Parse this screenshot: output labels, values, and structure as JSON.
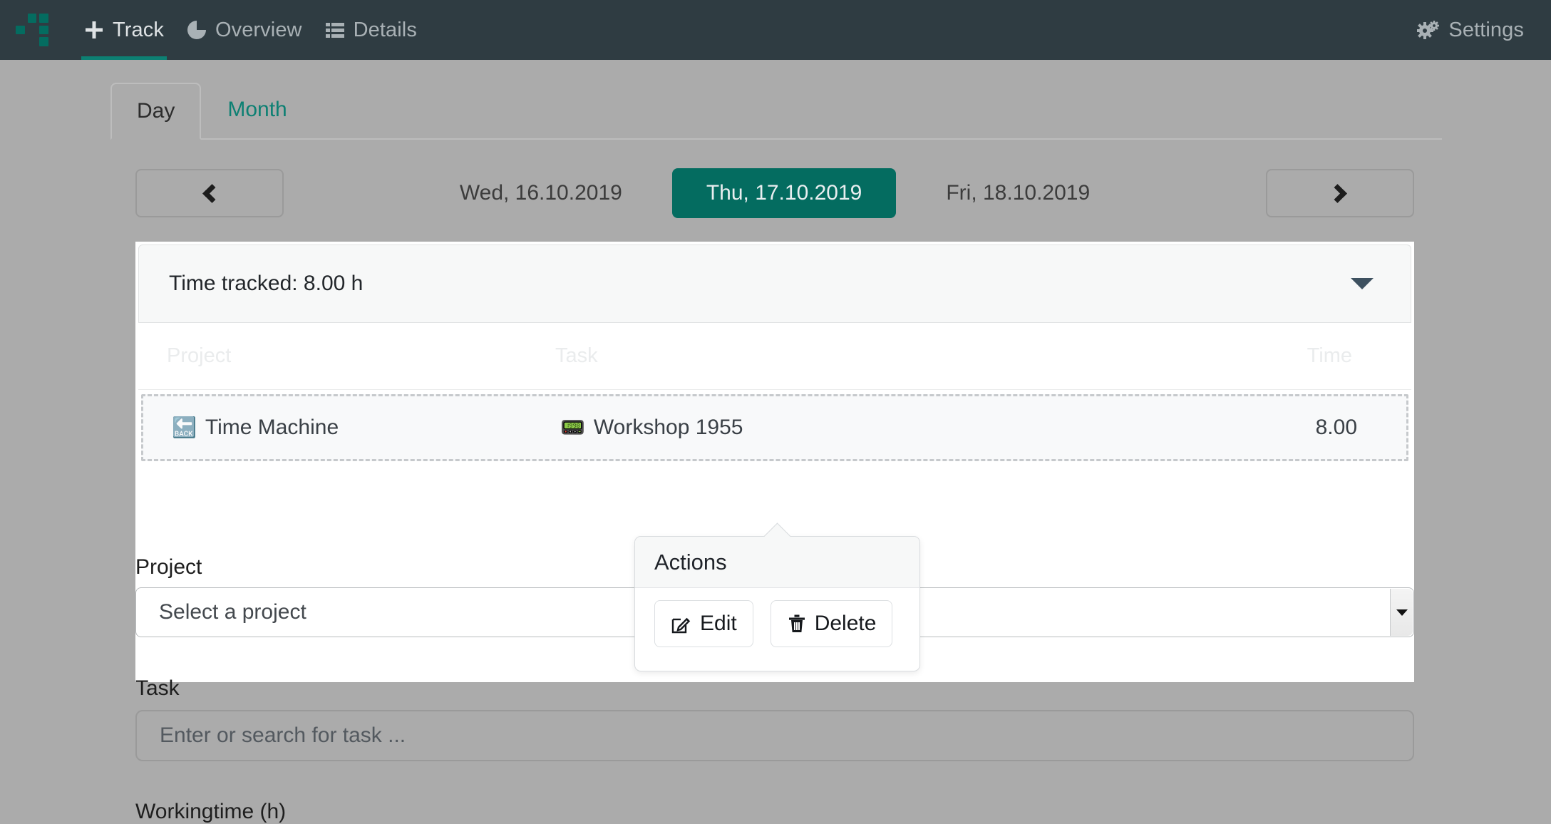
{
  "nav": {
    "logo_name": "timetracker-logo",
    "items": [
      {
        "label": "Track",
        "icon": "plus-icon",
        "active": true
      },
      {
        "label": "Overview",
        "icon": "pie-chart-icon",
        "active": false
      },
      {
        "label": "Details",
        "icon": "list-icon",
        "active": false
      }
    ],
    "settings": {
      "label": "Settings",
      "icon": "gears-icon"
    }
  },
  "tabs": [
    {
      "label": "Day",
      "active": true
    },
    {
      "label": "Month",
      "active": false
    }
  ],
  "date_nav": {
    "prev_icon": "chevron-left-icon",
    "next_icon": "chevron-right-icon",
    "dates": [
      {
        "label": "Wed, 16.10.2019",
        "current": false
      },
      {
        "label": "Thu, 17.10.2019",
        "current": true
      },
      {
        "label": "Fri, 18.10.2019",
        "current": false
      }
    ]
  },
  "summary": {
    "text": "Time tracked: 8.00 h",
    "collapse_icon": "chevron-down-icon"
  },
  "table": {
    "headers": {
      "project": "Project",
      "task": "Task",
      "time": "Time"
    },
    "rows": [
      {
        "project_icon": "🔙",
        "project": "Time Machine",
        "task_icon": "📟",
        "task": "Workshop 1955",
        "time": "8.00"
      }
    ]
  },
  "actions_popover": {
    "title": "Actions",
    "edit_label": "Edit",
    "delete_label": "Delete",
    "edit_icon": "pencil-square-icon",
    "delete_icon": "trash-icon"
  },
  "form": {
    "project_label": "Project",
    "project_placeholder": "Select a project",
    "task_label": "Task",
    "task_placeholder": "Enter or search for task ...",
    "workingtime_label": "Workingtime (h)"
  },
  "colors": {
    "nav_bg": "#2f3c42",
    "accent": "#046c60",
    "accent_text": "#0d8073",
    "page_bg": "#ababab",
    "panel_bg": "#ffffff"
  }
}
